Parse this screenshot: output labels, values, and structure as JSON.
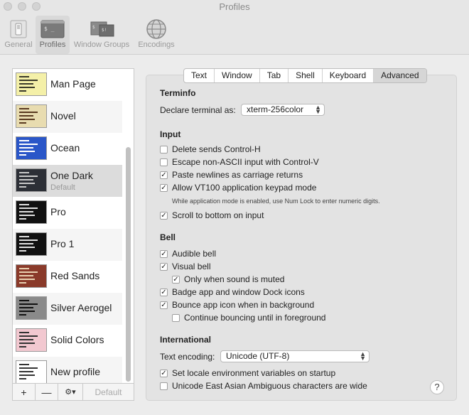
{
  "window": {
    "title": "Profiles"
  },
  "toolbar": [
    {
      "label": "General",
      "icon": "switch-icon"
    },
    {
      "label": "Profiles",
      "icon": "terminal-profile-icon"
    },
    {
      "label": "Window Groups",
      "icon": "window-groups-icon"
    },
    {
      "label": "Encodings",
      "icon": "globe-icon"
    }
  ],
  "profiles": [
    {
      "name": "Man Page",
      "sub": "",
      "colors": {
        "bg": "#f4f0a8",
        "fg": "#3a3a2a"
      }
    },
    {
      "name": "Novel",
      "sub": "",
      "colors": {
        "bg": "#e8dcb0",
        "fg": "#5a3a20"
      }
    },
    {
      "name": "Ocean",
      "sub": "",
      "colors": {
        "bg": "#2a56c8",
        "fg": "#ffffff"
      }
    },
    {
      "name": "One Dark",
      "sub": "Default",
      "colors": {
        "bg": "#2c2f36",
        "fg": "#c8c8c8"
      }
    },
    {
      "name": "Pro",
      "sub": "",
      "colors": {
        "bg": "#111111",
        "fg": "#e0e0e0"
      }
    },
    {
      "name": "Pro 1",
      "sub": "",
      "colors": {
        "bg": "#111111",
        "fg": "#e0e0e0"
      }
    },
    {
      "name": "Red Sands",
      "sub": "",
      "colors": {
        "bg": "#8a3a2a",
        "fg": "#e8d0b0"
      }
    },
    {
      "name": "Silver Aerogel",
      "sub": "",
      "colors": {
        "bg": "#8a8a8a",
        "fg": "#111111"
      }
    },
    {
      "name": "Solid Colors",
      "sub": "",
      "colors": {
        "bg": "#f2c8d0",
        "fg": "#333333"
      }
    },
    {
      "name": "New profile",
      "sub": "",
      "colors": {
        "bg": "#ffffff",
        "fg": "#333333"
      }
    }
  ],
  "list_toolbar": {
    "add": "+",
    "remove": "—",
    "gear": "⚙︎▾",
    "default": "Default"
  },
  "tabs": [
    "Text",
    "Window",
    "Tab",
    "Shell",
    "Keyboard",
    "Advanced"
  ],
  "active_tab": "Advanced",
  "terminfo": {
    "heading": "Terminfo",
    "declare_label": "Declare terminal as:",
    "declare_value": "xterm-256color"
  },
  "input": {
    "heading": "Input",
    "options": [
      {
        "label": "Delete sends Control-H",
        "checked": false
      },
      {
        "label": "Escape non-ASCII input with Control-V",
        "checked": false
      },
      {
        "label": "Paste newlines as carriage returns",
        "checked": true
      },
      {
        "label": "Allow VT100 application keypad mode",
        "checked": true
      }
    ],
    "note": "While application mode is enabled, use Num Lock to enter numeric digits.",
    "scroll": {
      "label": "Scroll to bottom on input",
      "checked": true
    }
  },
  "bell": {
    "heading": "Bell",
    "audible": {
      "label": "Audible bell",
      "checked": true
    },
    "visual": {
      "label": "Visual bell",
      "checked": true
    },
    "only_muted": {
      "label": "Only when sound is muted",
      "checked": true
    },
    "badge": {
      "label": "Badge app and window Dock icons",
      "checked": true
    },
    "bounce": {
      "label": "Bounce app icon when in background",
      "checked": true
    },
    "continue": {
      "label": "Continue bouncing until in foreground",
      "checked": false
    }
  },
  "international": {
    "heading": "International",
    "encoding_label": "Text encoding:",
    "encoding_value": "Unicode (UTF-8)",
    "locale": {
      "label": "Set locale environment variables on startup",
      "checked": true
    },
    "ambiguous": {
      "label": "Unicode East Asian Ambiguous characters are wide",
      "checked": false
    }
  },
  "help": "?"
}
